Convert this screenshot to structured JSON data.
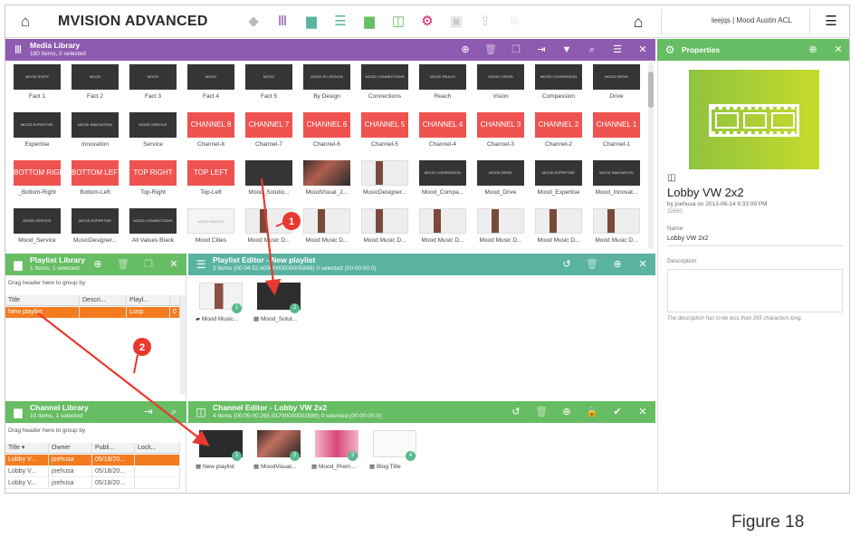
{
  "app": {
    "title": "MVISION ADVANCED",
    "user": "leejqs  |  Mood Austin ACL"
  },
  "topnav": [
    {
      "icon": "tag-icon",
      "glyph": "◆",
      "color": "#bbbbbb"
    },
    {
      "icon": "library-icon",
      "glyph": "Ⅲ",
      "color": "#8e5bb0"
    },
    {
      "icon": "folder-icon",
      "glyph": "▆",
      "color": "#5ab3a1"
    },
    {
      "icon": "list-icon",
      "glyph": "☰",
      "color": "#5ab3a1"
    },
    {
      "icon": "channel-folder-icon",
      "glyph": "▆",
      "color": "#66bd63"
    },
    {
      "icon": "channel-icon",
      "glyph": "◫",
      "color": "#66bd63"
    },
    {
      "icon": "gear-icon",
      "glyph": "⚙",
      "color": "#d81b60"
    },
    {
      "icon": "inbox-icon",
      "glyph": "▣",
      "color": "#cccccc"
    },
    {
      "icon": "upload-icon",
      "glyph": "⇪",
      "color": "#cccccc"
    },
    {
      "icon": "pin-icon",
      "glyph": "⌾",
      "color": "#cccccc"
    }
  ],
  "media_library": {
    "title": "Media Library",
    "subtitle": "180 Items, 0 selected",
    "color": "#8e5bb0",
    "rows": [
      [
        {
          "thumb": "MOOD STATE",
          "kind": "dark",
          "label": "Fact 1"
        },
        {
          "thumb": "MOOD",
          "kind": "dark",
          "label": "Fact 2"
        },
        {
          "thumb": "MOOD",
          "kind": "dark",
          "label": "Fact 3"
        },
        {
          "thumb": "MOOD",
          "kind": "dark",
          "label": "Fact 4"
        },
        {
          "thumb": "MOOD",
          "kind": "dark",
          "label": "Fact 5"
        },
        {
          "thumb": "MOOD BY DESIGN",
          "kind": "dark",
          "label": "By Design"
        },
        {
          "thumb": "MOOD CONNECTIONS",
          "kind": "dark",
          "label": "Connections"
        },
        {
          "thumb": "MOOD REACH",
          "kind": "dark",
          "label": "Reach"
        },
        {
          "thumb": "MOOD VISION",
          "kind": "dark",
          "label": "Vision"
        },
        {
          "thumb": "MOOD COMPASSION",
          "kind": "dark",
          "label": "Compassion"
        },
        {
          "thumb": "MOOD DRIVE",
          "kind": "dark",
          "label": "Drive"
        }
      ],
      [
        {
          "thumb": "MOOD EXPERTISE",
          "kind": "dark",
          "label": "Expertise"
        },
        {
          "thumb": "MOOD INNOVATION",
          "kind": "dark",
          "label": "Innovation"
        },
        {
          "thumb": "MOOD SERVICE",
          "kind": "dark",
          "label": "Service"
        },
        {
          "thumb": "CHANNEL 8",
          "kind": "red",
          "label": "Channel-8"
        },
        {
          "thumb": "CHANNEL 7",
          "kind": "red",
          "label": "Channel-7"
        },
        {
          "thumb": "CHANNEL 6",
          "kind": "red",
          "label": "Channel-6"
        },
        {
          "thumb": "CHANNEL 5",
          "kind": "red",
          "label": "Channel-5"
        },
        {
          "thumb": "CHANNEL 4",
          "kind": "red",
          "label": "Channel-4"
        },
        {
          "thumb": "CHANNEL 3",
          "kind": "red",
          "label": "Channel-3"
        },
        {
          "thumb": "CHANNEL 2",
          "kind": "red",
          "label": "Channel-2"
        },
        {
          "thumb": "CHANNEL 1",
          "kind": "red",
          "label": "Channel-1"
        }
      ],
      [
        {
          "thumb": "BOTTOM RIGHT",
          "kind": "red",
          "label": "_Bottom-Right"
        },
        {
          "thumb": "BOTTOM LEFT",
          "kind": "red",
          "label": "Bottom-Left"
        },
        {
          "thumb": "TOP RIGHT",
          "kind": "red",
          "label": "Top-Right"
        },
        {
          "thumb": "TOP LEFT",
          "kind": "red",
          "label": "Top-Left"
        },
        {
          "thumb": "",
          "kind": "dark",
          "label": "Mood_Solutio..."
        },
        {
          "thumb": "",
          "kind": "video",
          "label": "MoodVisual_2..."
        },
        {
          "thumb": "",
          "kind": "photo",
          "label": "MusicDesigner..."
        },
        {
          "thumb": "MOOD COMPASSION",
          "kind": "dark",
          "label": "Mood_Compa..."
        },
        {
          "thumb": "MOOD DRIVE",
          "kind": "dark",
          "label": "Mood_Drive"
        },
        {
          "thumb": "MOOD EXPERTISE",
          "kind": "dark",
          "label": "Mood_Expertise"
        },
        {
          "thumb": "MOOD INNOVATION",
          "kind": "dark",
          "label": "Mood_Innovat..."
        }
      ],
      [
        {
          "thumb": "MOOD SERVICE",
          "kind": "dark",
          "label": "Mood_Service"
        },
        {
          "thumb": "MOOD EXPERTISE",
          "kind": "dark",
          "label": "MusicDesigner..."
        },
        {
          "thumb": "MOOD CONNECTIONS",
          "kind": "dark",
          "label": "All Values Black"
        },
        {
          "thumb": "MOOD VALUES",
          "kind": "light",
          "label": "Mood Cities"
        },
        {
          "thumb": "",
          "kind": "photo",
          "label": "Mood Music D..."
        },
        {
          "thumb": "",
          "kind": "photo",
          "label": "Mood Music D..."
        },
        {
          "thumb": "",
          "kind": "photo",
          "label": "Mood Music D..."
        },
        {
          "thumb": "",
          "kind": "photo",
          "label": "Mood Music D..."
        },
        {
          "thumb": "",
          "kind": "photo",
          "label": "Mood Music D..."
        },
        {
          "thumb": "",
          "kind": "photo",
          "label": "Mood Music D..."
        },
        {
          "thumb": "",
          "kind": "photo",
          "label": "Mood Music D..."
        }
      ]
    ]
  },
  "playlist_library": {
    "title": "Playlist Library",
    "subtitle": "1 Items, 1 selected",
    "group_hint": "Drag header here to group by",
    "columns": [
      "Title",
      "Descri...",
      "Playl...",
      ""
    ],
    "rows": [
      {
        "cells": [
          "New playlist",
          "",
          "Loop",
          "0"
        ],
        "selected": true
      }
    ]
  },
  "playlist_editor": {
    "title": "Playlist Editor - New playlist",
    "subtitle": "2 Items (00:04:52.6000000000005849) 0 selected (00:00:00.0)",
    "items": [
      {
        "badge": "1",
        "label": "Mood Music...",
        "kind": "photo"
      },
      {
        "badge": "2",
        "label": "Mood_Solut...",
        "kind": "dark"
      }
    ]
  },
  "channel_library": {
    "title": "Channel Library",
    "subtitle": "10 Items, 1 selected",
    "group_hint": "Drag header here to group by",
    "columns": [
      "Title ▾",
      "Owner",
      "Publi...",
      "Lock..."
    ],
    "rows": [
      {
        "cells": [
          "Lobby V...",
          "joehusa",
          "05/18/20...",
          ""
        ],
        "selected": true
      },
      {
        "cells": [
          "Lobby V...",
          "joehusa",
          "05/18/20...",
          ""
        ],
        "selected": false
      },
      {
        "cells": [
          "Lobby V...",
          "joehusa",
          "05/18/20...",
          ""
        ],
        "selected": false
      }
    ]
  },
  "channel_editor": {
    "title": "Channel Editor - Lobby VW 2x2",
    "subtitle": "4 Items (00:05:00.265.91700000001589) 0 selected (00:00:00.0)",
    "items": [
      {
        "badge": "1",
        "label": "New playlist",
        "kind": "list"
      },
      {
        "badge": "2",
        "label": "MoodVisual...",
        "kind": "video"
      },
      {
        "badge": "3",
        "label": "Mood_Prem...",
        "kind": "pink"
      },
      {
        "badge": "4",
        "label": "Blog Title",
        "kind": "media"
      }
    ]
  },
  "properties": {
    "title": "Properties",
    "name": "Lobby VW 2x2",
    "by_line": "by joehusa on 2013-06-14 6:33:09 PM",
    "id": "32650",
    "name_label": "Name",
    "name_value": "Lobby VW 2x2",
    "description_label": "Description",
    "description_hint": "The description has to be less than 255 characters long."
  },
  "annotations": [
    {
      "number": "1"
    },
    {
      "number": "2"
    }
  ],
  "caption": "Figure 18"
}
